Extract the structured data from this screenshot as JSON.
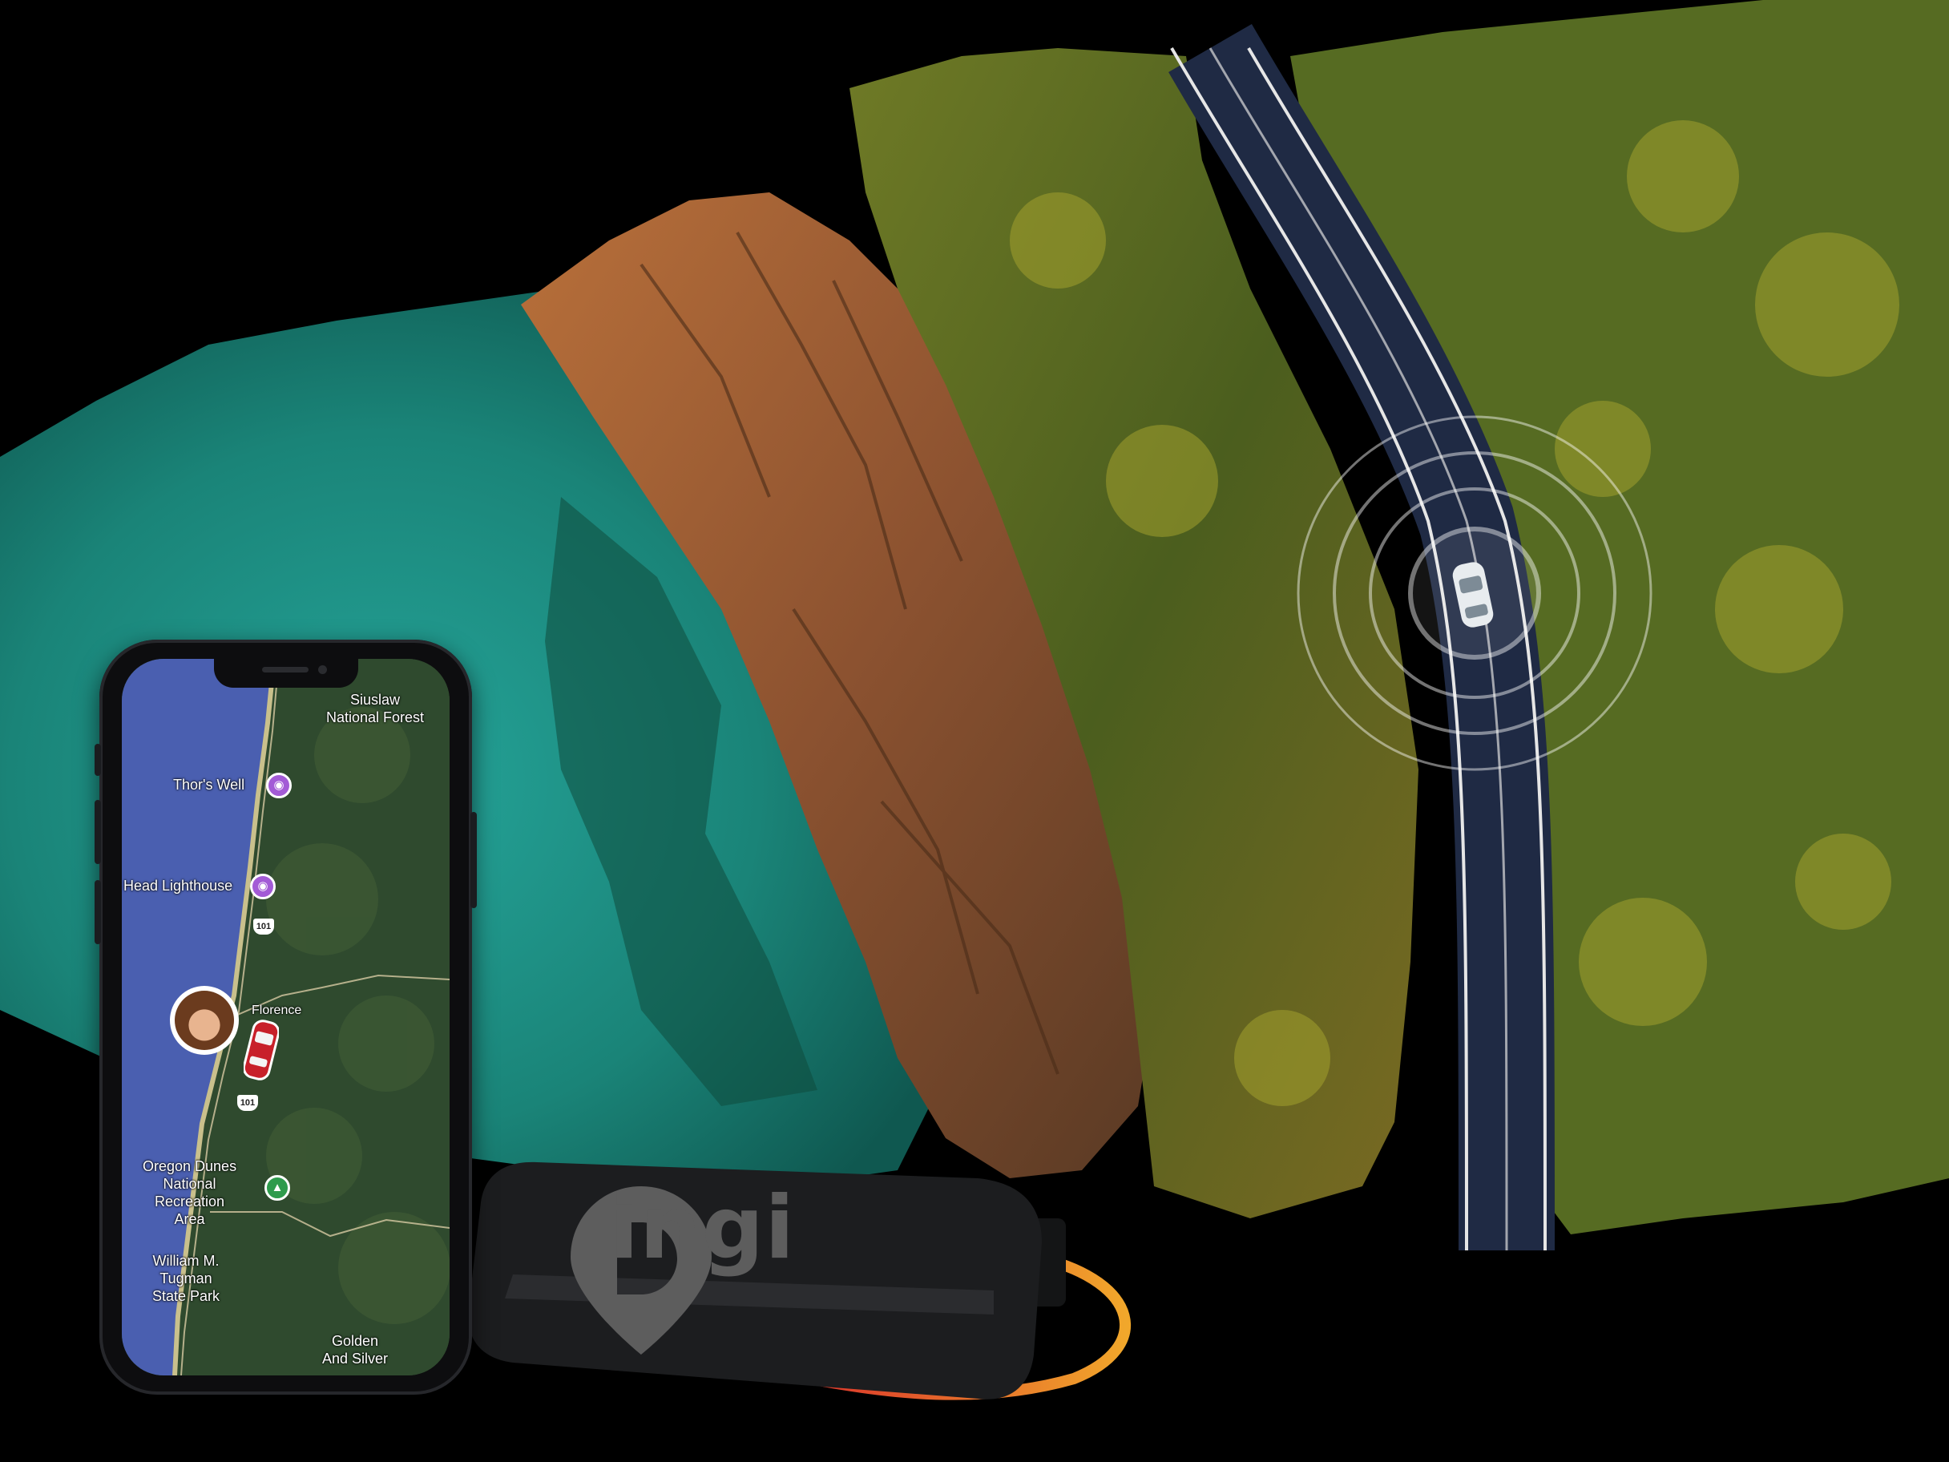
{
  "brand": {
    "device_label": "ingi"
  },
  "map": {
    "labels": {
      "siuslaw": "Siuslaw\nNational Forest",
      "thors_well": "Thor's Well",
      "lighthouse": "Head Lighthouse",
      "florence": "Florence",
      "oregon_dunes": "Oregon Dunes\nNational\nRecreation\nArea",
      "tugman": "William M.\nTugman\nState Park",
      "golden": "Golden\nAnd Silver",
      "route_101_a": "101",
      "route_101_b": "101"
    }
  },
  "colors": {
    "ocean_map": "#4a5fb0",
    "land_map": "#2f4a2e",
    "sea": "#1f8a7f",
    "road": "#1f2a44",
    "device": "#1c1d1f",
    "poi_purple": "#a35bd6",
    "poi_green": "#2e9b4c",
    "car_red": "#c8202a"
  }
}
